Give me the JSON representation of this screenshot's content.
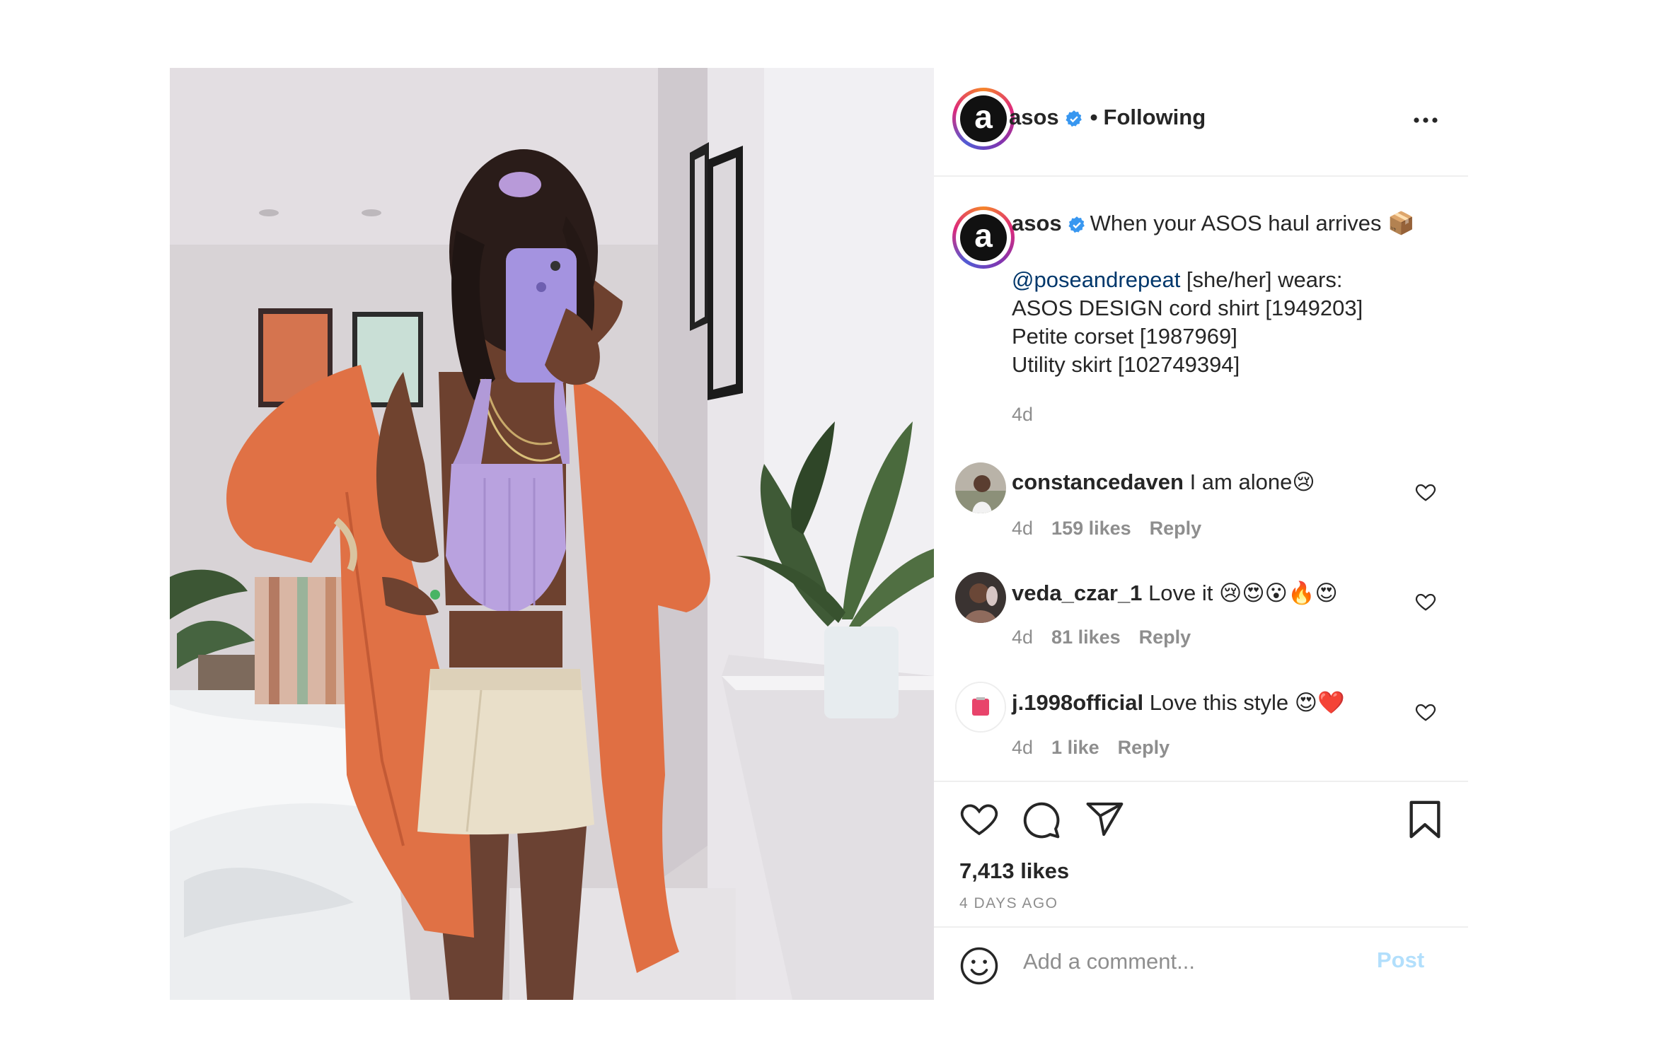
{
  "header": {
    "username": "asos",
    "separator": "•",
    "follow_status": "Following"
  },
  "caption": {
    "username": "asos",
    "headline": "When your ASOS haul arrives 📦",
    "mention": "@poseandrepeat",
    "mention_suffix": " [she/her] wears:",
    "lines": [
      "ASOS DESIGN cord shirt [1949203]",
      "Petite corset [1987969]",
      "Utility skirt [102749394]"
    ],
    "age": "4d"
  },
  "comments": [
    {
      "username": "constancedaven",
      "text": "I am alone😢",
      "age": "4d",
      "likes": "159 likes",
      "reply": "Reply"
    },
    {
      "username": "veda_czar_1",
      "text": "Love it 😢😍😮🔥😍",
      "age": "4d",
      "likes": "81 likes",
      "reply": "Reply"
    },
    {
      "username": "j.1998official",
      "text": "Love this style 😍❤️",
      "age": "4d",
      "likes": "1 like",
      "reply": "Reply"
    }
  ],
  "footer": {
    "likes": "7,413 likes",
    "time_ago": "4 DAYS AGO",
    "comment_placeholder": "Add a comment...",
    "post_label": "Post"
  },
  "colors": {
    "verified_blue": "#3897f0",
    "link_blue": "#00376b",
    "muted_gray": "#8e8e8e",
    "post_button_disabled": "#b2dffc"
  }
}
